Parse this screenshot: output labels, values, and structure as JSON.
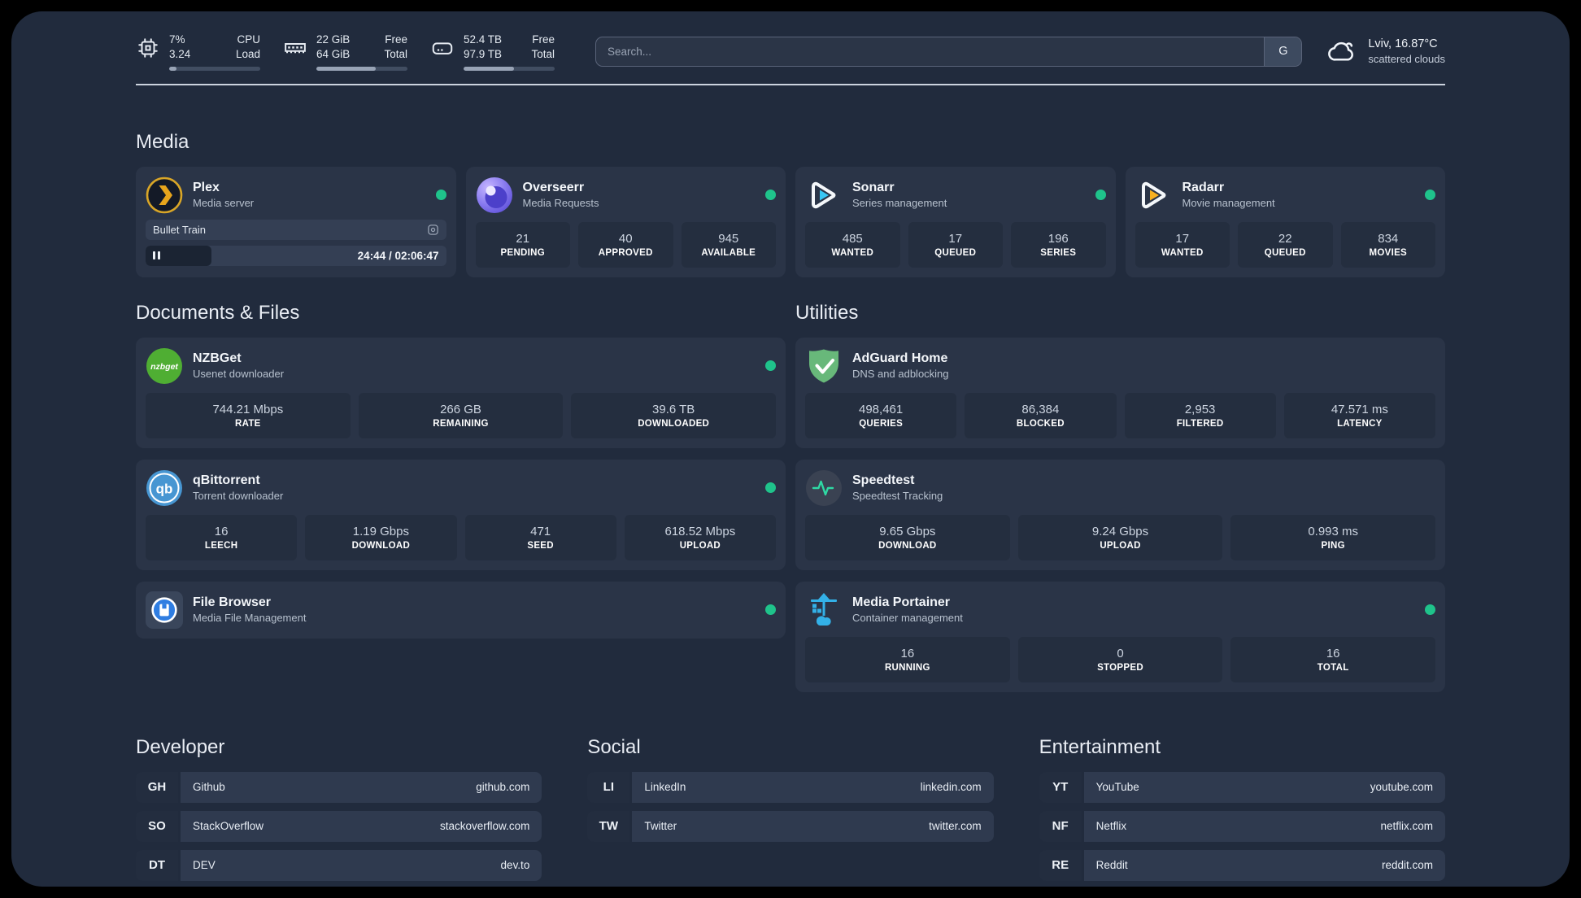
{
  "colors": {
    "page_bg": "#000000",
    "panel_bg": "#212b3d",
    "card_bg": "#2a3447",
    "stat_bg": "#242e3f",
    "status_online": "#1fc38b",
    "divider": "#ccd3de",
    "plex_amber": "#e8a51c",
    "sonarr_blue": "#38c6f4",
    "radarr_orange": "#f7b020",
    "nzbget_green": "#4fae33",
    "qbittorrent_blue": "#4796d2",
    "adguard_green": "#68b87a",
    "speedtest_pulse": "#2fd9a4",
    "portainer_blue": "#33b1e8",
    "filebrowser_blue": "#2f7de1",
    "overseerr_purple": "#8a7cf0"
  },
  "header": {
    "cpu": {
      "icon": "cpu-icon",
      "v1": "7%",
      "v2": "3.24",
      "l1": "CPU",
      "l2": "Load",
      "progress_pct": 8
    },
    "ram": {
      "icon": "ram-icon",
      "v1": "22 GiB",
      "v2": "64 GiB",
      "l1": "Free",
      "l2": "Total",
      "progress_pct": 65
    },
    "disk": {
      "icon": "disk-icon",
      "v1": "52.4 TB",
      "v2": "97.9 TB",
      "l1": "Free",
      "l2": "Total",
      "progress_pct": 55
    },
    "search": {
      "placeholder": "Search...",
      "button": "G"
    },
    "weather": {
      "icon": "cloud-icon",
      "location": "Lviv, 16.87°C",
      "condition": "scattered clouds"
    }
  },
  "sections": {
    "media": "Media",
    "documents": "Documents & Files",
    "utilities": "Utilities",
    "developer": "Developer",
    "social": "Social",
    "entertainment": "Entertainment"
  },
  "apps": {
    "plex": {
      "icon": "plex-icon",
      "name": "Plex",
      "subtitle": "Media server",
      "player": {
        "title": "Bullet Train",
        "time": "24:44 / 02:06:47",
        "progress_pct": 19.5
      }
    },
    "overseerr": {
      "icon": "overseerr-icon",
      "name": "Overseerr",
      "subtitle": "Media Requests",
      "stats": [
        {
          "value": "21",
          "label": "PENDING"
        },
        {
          "value": "40",
          "label": "APPROVED"
        },
        {
          "value": "945",
          "label": "AVAILABLE"
        }
      ]
    },
    "sonarr": {
      "icon": "sonarr-icon",
      "name": "Sonarr",
      "subtitle": "Series management",
      "stats": [
        {
          "value": "485",
          "label": "WANTED"
        },
        {
          "value": "17",
          "label": "QUEUED"
        },
        {
          "value": "196",
          "label": "SERIES"
        }
      ]
    },
    "radarr": {
      "icon": "radarr-icon",
      "name": "Radarr",
      "subtitle": "Movie management",
      "stats": [
        {
          "value": "17",
          "label": "WANTED"
        },
        {
          "value": "22",
          "label": "QUEUED"
        },
        {
          "value": "834",
          "label": "MOVIES"
        }
      ]
    },
    "nzbget": {
      "icon": "nzbget-icon",
      "name": "NZBGet",
      "subtitle": "Usenet downloader",
      "stats": [
        {
          "value": "744.21 Mbps",
          "label": "RATE"
        },
        {
          "value": "266 GB",
          "label": "REMAINING"
        },
        {
          "value": "39.6 TB",
          "label": "DOWNLOADED"
        }
      ]
    },
    "qbittorrent": {
      "icon": "qbittorrent-icon",
      "name": "qBittorrent",
      "subtitle": "Torrent downloader",
      "stats": [
        {
          "value": "16",
          "label": "LEECH"
        },
        {
          "value": "1.19 Gbps",
          "label": "DOWNLOAD"
        },
        {
          "value": "471",
          "label": "SEED"
        },
        {
          "value": "618.52 Mbps",
          "label": "UPLOAD"
        }
      ]
    },
    "filebrowser": {
      "icon": "filebrowser-icon",
      "name": "File Browser",
      "subtitle": "Media File Management"
    },
    "adguard": {
      "icon": "adguard-icon",
      "name": "AdGuard Home",
      "subtitle": "DNS and adblocking",
      "stats": [
        {
          "value": "498,461",
          "label": "QUERIES"
        },
        {
          "value": "86,384",
          "label": "BLOCKED"
        },
        {
          "value": "2,953",
          "label": "FILTERED"
        },
        {
          "value": "47.571 ms",
          "label": "LATENCY"
        }
      ]
    },
    "speedtest": {
      "icon": "speedtest-icon",
      "name": "Speedtest",
      "subtitle": "Speedtest Tracking",
      "stats": [
        {
          "value": "9.65 Gbps",
          "label": "DOWNLOAD"
        },
        {
          "value": "9.24 Gbps",
          "label": "UPLOAD"
        },
        {
          "value": "0.993 ms",
          "label": "PING"
        }
      ]
    },
    "portainer": {
      "icon": "portainer-icon",
      "name": "Media Portainer",
      "subtitle": "Container management",
      "stats": [
        {
          "value": "16",
          "label": "RUNNING"
        },
        {
          "value": "0",
          "label": "STOPPED"
        },
        {
          "value": "16",
          "label": "TOTAL"
        }
      ]
    }
  },
  "bookmarks": {
    "developer": [
      {
        "abbr": "GH",
        "name": "Github",
        "url": "github.com"
      },
      {
        "abbr": "SO",
        "name": "StackOverflow",
        "url": "stackoverflow.com"
      },
      {
        "abbr": "DT",
        "name": "DEV",
        "url": "dev.to"
      }
    ],
    "social": [
      {
        "abbr": "LI",
        "name": "LinkedIn",
        "url": "linkedin.com"
      },
      {
        "abbr": "TW",
        "name": "Twitter",
        "url": "twitter.com"
      }
    ],
    "entertainment": [
      {
        "abbr": "YT",
        "name": "YouTube",
        "url": "youtube.com"
      },
      {
        "abbr": "NF",
        "name": "Netflix",
        "url": "netflix.com"
      },
      {
        "abbr": "RE",
        "name": "Reddit",
        "url": "reddit.com"
      }
    ]
  }
}
